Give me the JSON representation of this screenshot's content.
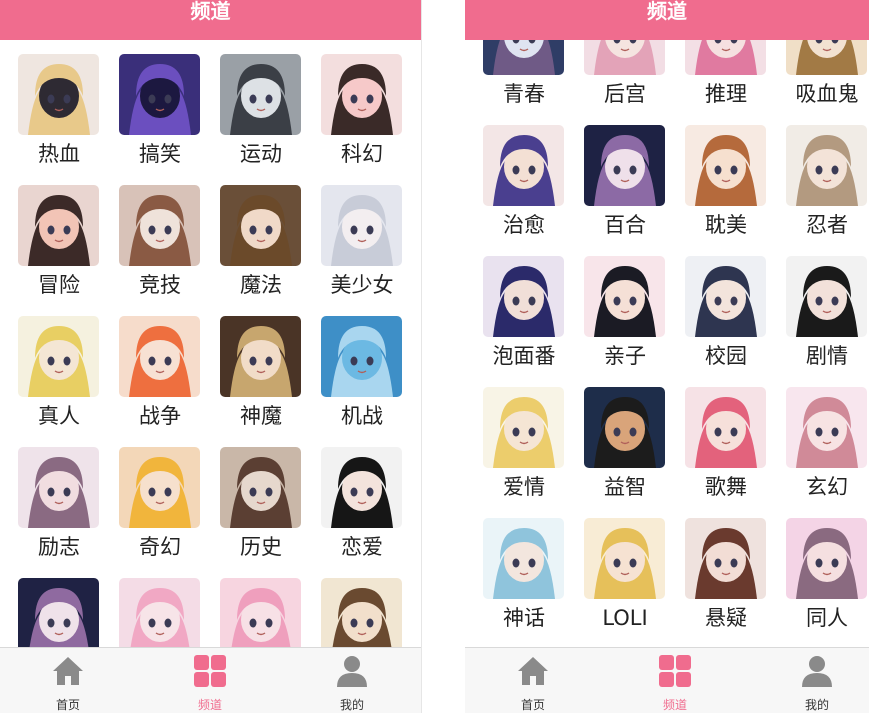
{
  "colors": {
    "accent": "#f06c8e",
    "tab_inactive": "#8a8a8a",
    "divider": "#d9d9d9"
  },
  "panels": [
    {
      "header": {
        "title": "频道"
      },
      "channels": [
        {
          "label": "热血",
          "palette": [
            "#efe6e0",
            "#e8c98a",
            "#2e2a33"
          ]
        },
        {
          "label": "搞笑",
          "palette": [
            "#3a2f7a",
            "#6b4fbf",
            "#1c1840"
          ]
        },
        {
          "label": "运动",
          "palette": [
            "#9aa0a6",
            "#3b3f46",
            "#dde1e5"
          ]
        },
        {
          "label": "科幻",
          "palette": [
            "#f3dede",
            "#3a2a28",
            "#f6c9c9"
          ]
        },
        {
          "label": "冒险",
          "palette": [
            "#e9d5d0",
            "#3c2a28",
            "#f2c4b6"
          ]
        },
        {
          "label": "竞技",
          "palette": [
            "#d8c2b8",
            "#8a5a44",
            "#efe2da"
          ]
        },
        {
          "label": "魔法",
          "palette": [
            "#6a4f38",
            "#6b4a2a",
            "#f0d9c8"
          ]
        },
        {
          "label": "美少女",
          "palette": [
            "#e4e6ee",
            "#c8ccd8",
            "#f3eef0"
          ]
        },
        {
          "label": "真人",
          "palette": [
            "#f5f1df",
            "#e8cf63",
            "#f4e6d4"
          ]
        },
        {
          "label": "战争",
          "palette": [
            "#f6dccb",
            "#ee6f3f",
            "#f7e1d3"
          ]
        },
        {
          "label": "神魔",
          "palette": [
            "#4a3426",
            "#c7a66e",
            "#f1dcc8"
          ]
        },
        {
          "label": "机战",
          "palette": [
            "#3e8fc7",
            "#a9d6ef",
            "#6cb9e3"
          ]
        },
        {
          "label": "励志",
          "palette": [
            "#efe3ea",
            "#8a6a82",
            "#f1dde0"
          ]
        },
        {
          "label": "奇幻",
          "palette": [
            "#f3d7b8",
            "#f1b53c",
            "#f6e0cd"
          ]
        },
        {
          "label": "历史",
          "palette": [
            "#c9b7a8",
            "#5b3f33",
            "#e6d8cd"
          ]
        },
        {
          "label": "恋爱",
          "palette": [
            "#f2f2f2",
            "#161616",
            "#f3e3dc"
          ]
        },
        {
          "label": "",
          "palette": [
            "#1f2244",
            "#8f6aa0",
            "#efe2ea"
          ]
        },
        {
          "label": "",
          "palette": [
            "#f4dce6",
            "#f1a8c4",
            "#f7e4e8"
          ]
        },
        {
          "label": "",
          "palette": [
            "#f7d5e0",
            "#ef9fbd",
            "#f7e1e6"
          ]
        },
        {
          "label": "",
          "palette": [
            "#f1e6d2",
            "#6a4a30",
            "#f2dfcb"
          ]
        }
      ],
      "tabbar": {
        "items": [
          {
            "label": "首页"
          },
          {
            "label": "频道"
          },
          {
            "label": "我的"
          }
        ],
        "active": 1
      }
    },
    {
      "header": {
        "title": "频道"
      },
      "channels": [
        {
          "label": "青春",
          "palette": [
            "#2f3d66",
            "#6f5a86",
            "#dfe4f1"
          ]
        },
        {
          "label": "后宫",
          "palette": [
            "#f2dde4",
            "#e3a3b8",
            "#f5e4e0"
          ]
        },
        {
          "label": "推理",
          "palette": [
            "#f3dfe5",
            "#e07aa0",
            "#f5e0e0"
          ]
        },
        {
          "label": "吸血鬼",
          "palette": [
            "#f0dfc7",
            "#a27a45",
            "#f2e2d1"
          ]
        },
        {
          "label": "治愈",
          "palette": [
            "#f3e6e6",
            "#4a3f8f",
            "#f3e0d4"
          ]
        },
        {
          "label": "百合",
          "palette": [
            "#1e2244",
            "#8c6aa5",
            "#efe0ea"
          ]
        },
        {
          "label": "耽美",
          "palette": [
            "#f7eae2",
            "#b56a3c",
            "#f6e0cf"
          ]
        },
        {
          "label": "忍者",
          "palette": [
            "#f1ece6",
            "#b39a80",
            "#f3e3d8"
          ]
        },
        {
          "label": "泡面番",
          "palette": [
            "#e9e2ef",
            "#2b2a6a",
            "#f1dfd8"
          ]
        },
        {
          "label": "亲子",
          "palette": [
            "#f8e5ea",
            "#1b1b24",
            "#f5e0d6"
          ]
        },
        {
          "label": "校园",
          "palette": [
            "#eef0f4",
            "#2e3550",
            "#f3e4dc"
          ]
        },
        {
          "label": "剧情",
          "palette": [
            "#f2f2f2",
            "#1a1a1a",
            "#f2e1da"
          ]
        },
        {
          "label": "爱情",
          "palette": [
            "#f8f4e6",
            "#eccd6c",
            "#f5e5d4"
          ]
        },
        {
          "label": "益智",
          "palette": [
            "#1e2d4a",
            "#1c1c1c",
            "#d9a47a"
          ]
        },
        {
          "label": "歌舞",
          "palette": [
            "#f6e2e6",
            "#e3627c",
            "#f6e0da"
          ]
        },
        {
          "label": "玄幻",
          "palette": [
            "#f8e6ee",
            "#d08a98",
            "#f7e3e3"
          ]
        },
        {
          "label": "神话",
          "palette": [
            "#eaf4f8",
            "#8fc4dc",
            "#f3e6de"
          ]
        },
        {
          "label": "LOLI",
          "palette": [
            "#f8ecd5",
            "#e6c05a",
            "#f6e2d2"
          ]
        },
        {
          "label": "悬疑",
          "palette": [
            "#efe2de",
            "#6a3a2e",
            "#f2ddd5"
          ]
        },
        {
          "label": "同人",
          "palette": [
            "#f4d4e6",
            "#8a6a80",
            "#f5dfe0"
          ]
        }
      ],
      "tabbar": {
        "items": [
          {
            "label": "首页"
          },
          {
            "label": "频道"
          },
          {
            "label": "我的"
          }
        ],
        "active": 1
      }
    }
  ]
}
